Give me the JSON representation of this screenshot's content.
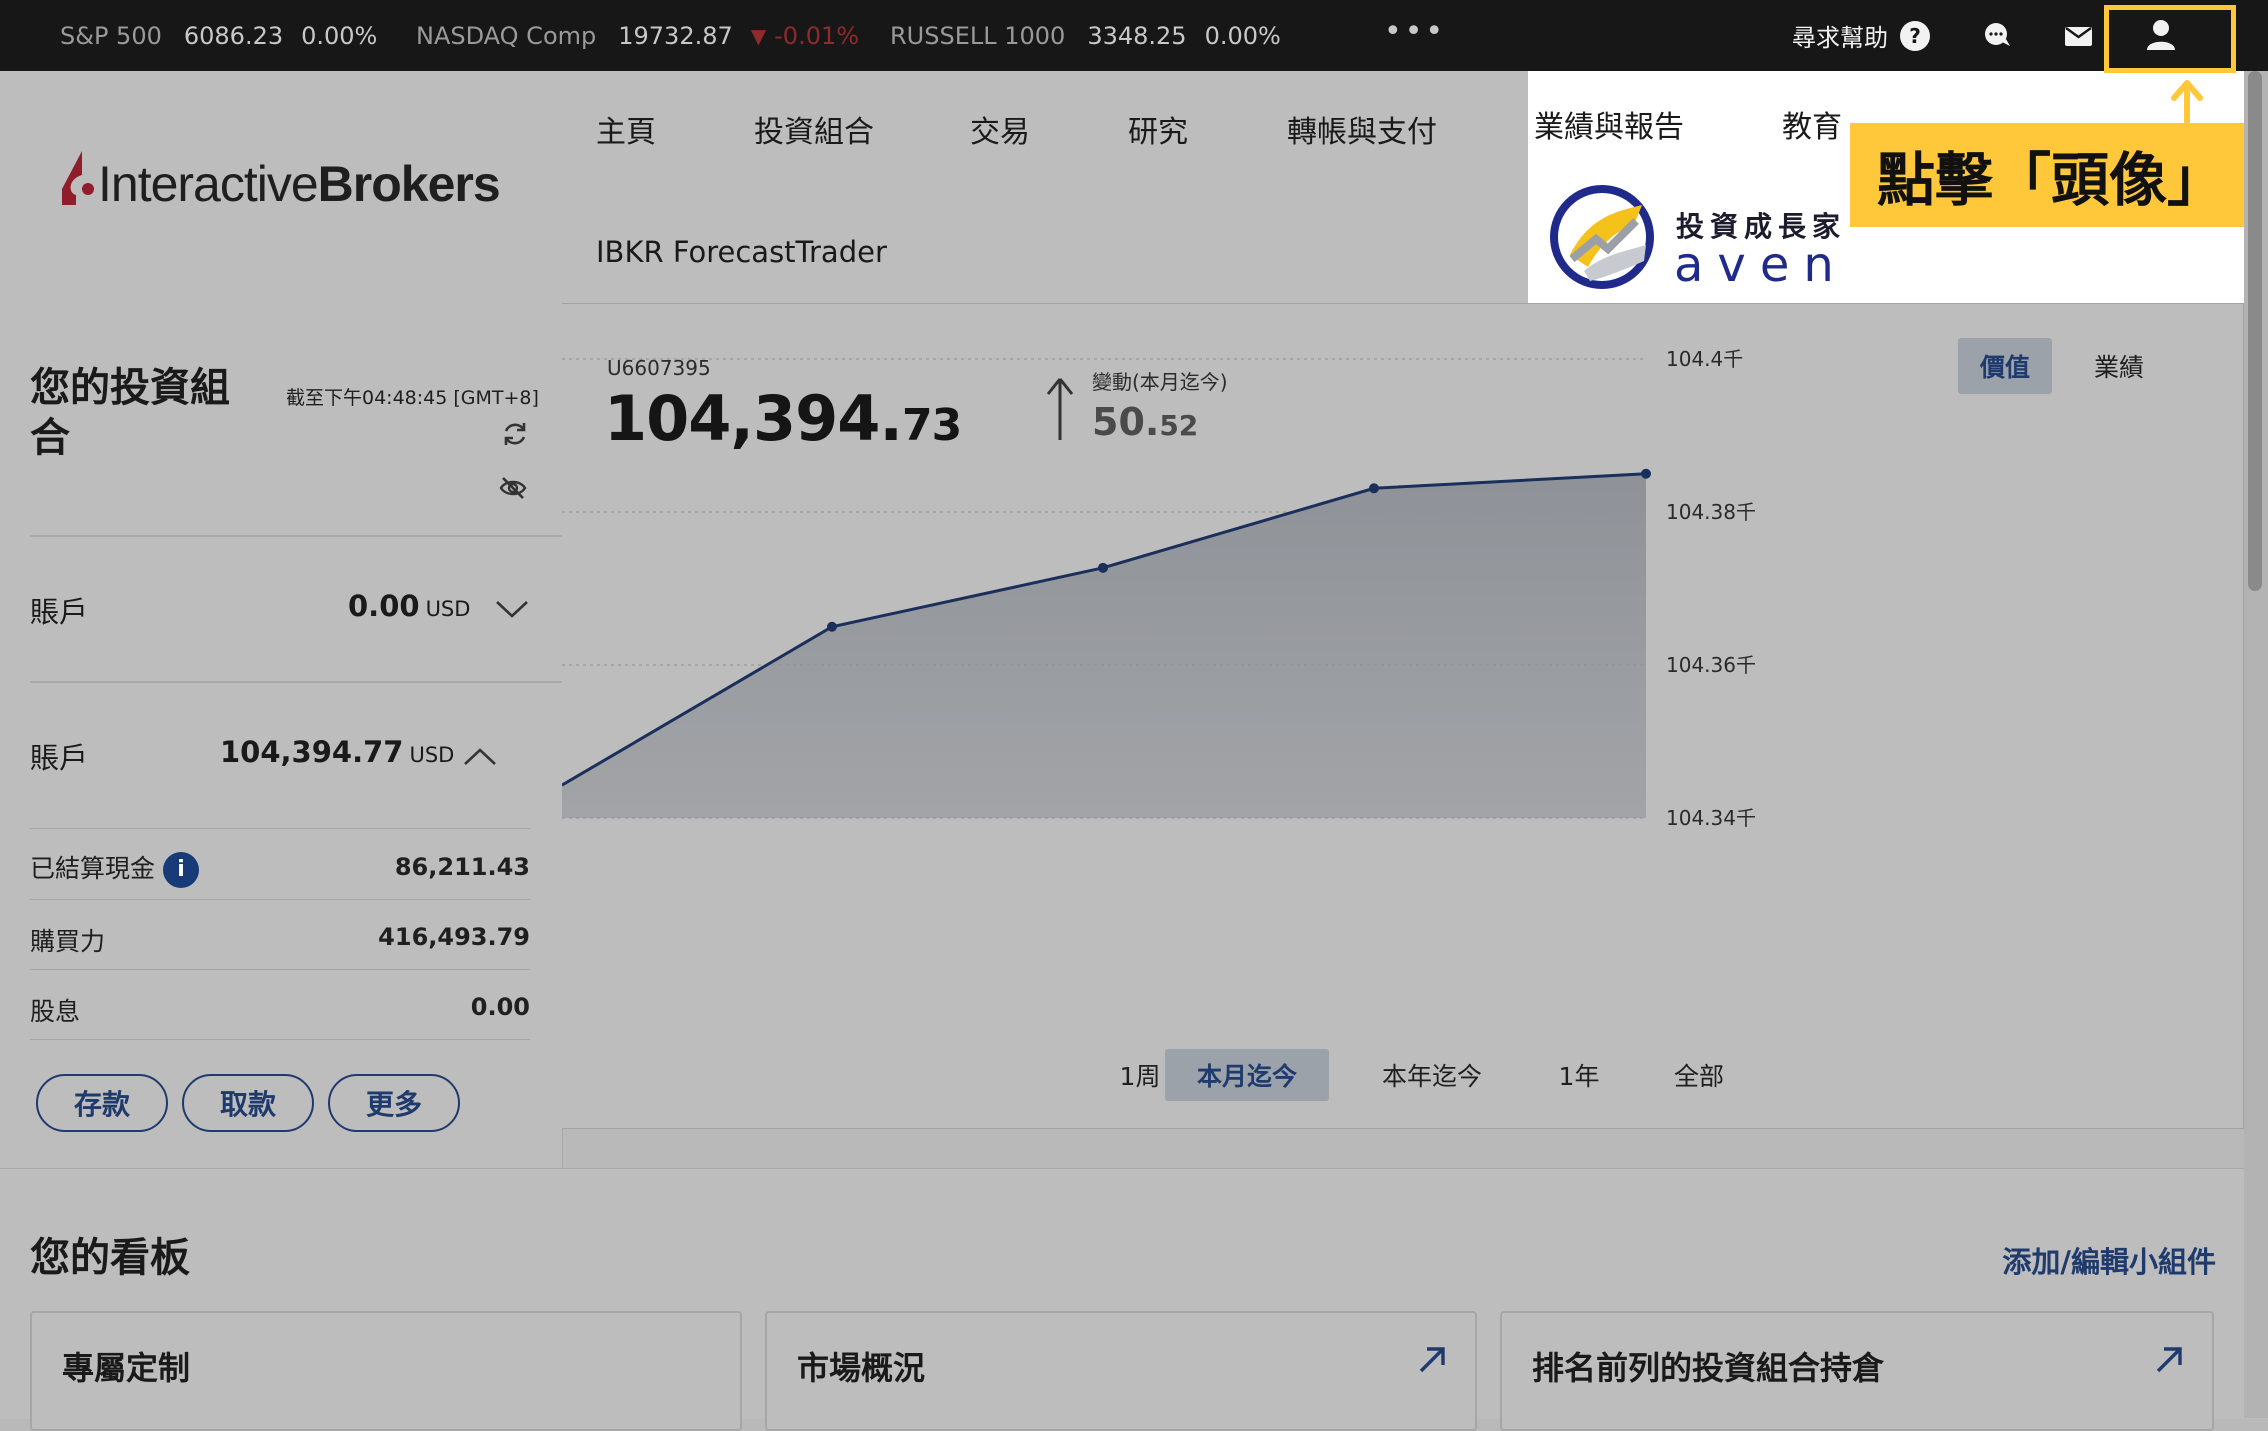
{
  "ticker": {
    "items": [
      {
        "name": "S&P 500",
        "value": "6086.23",
        "change": "0.00%"
      },
      {
        "name": "NASDAQ Comp",
        "value": "19732.87",
        "change": "-0.01%"
      },
      {
        "name": "RUSSELL 1000",
        "value": "3348.25",
        "change": "0.00%"
      }
    ],
    "more": "•••",
    "help_label": "尋求幫助",
    "help_glyph": "?"
  },
  "brand": {
    "left": "Interactive",
    "right": "Brokers"
  },
  "nav": {
    "items": [
      "主頁",
      "投資組合",
      "交易",
      "研究",
      "轉帳與支付",
      "業績與報告",
      "教育"
    ],
    "row2": "IBKR ForecastTrader"
  },
  "overlay": {
    "callout": "點擊「頭像」",
    "brand_cn": "投資成長家",
    "brand_en": "aven"
  },
  "portfolio": {
    "title": "您的投資組合",
    "timestamp": "截至下午04:48:45 [GMT+8]",
    "account1": {
      "label": "賬戶",
      "value": "0.00",
      "currency": "USD"
    },
    "account2": {
      "label": "賬戶",
      "value": "104,394.77",
      "currency": "USD"
    },
    "rows": [
      {
        "label": "已結算現金",
        "value": "86,211.43"
      },
      {
        "label": "購買力",
        "value": "416,493.79"
      },
      {
        "label": "股息",
        "value": "0.00"
      }
    ],
    "buttons": [
      "存款",
      "取款",
      "更多"
    ]
  },
  "summary": {
    "account_id": "U6607395",
    "value_main": "104,394.",
    "value_cents": "73",
    "change_label": "變動(本月迄今)",
    "change_main": "50.",
    "change_cents": "52",
    "toggle": [
      "價值",
      "業績"
    ],
    "ranges": [
      "1周",
      "本月迄今",
      "本年迄今",
      "1年",
      "全部"
    ],
    "active_range": "本月迄今"
  },
  "chart_data": {
    "type": "area",
    "x": [
      0,
      1,
      2,
      3,
      4
    ],
    "values": [
      104.3443,
      104.365,
      104.3727,
      104.3831,
      104.385
    ],
    "ylim": [
      104.34,
      104.4
    ],
    "y_ticks": [
      "104.4千",
      "104.38千",
      "104.36千",
      "104.34千"
    ],
    "y_tick_values": [
      104.4,
      104.38,
      104.36,
      104.34
    ],
    "grid": true,
    "line_color": "#1b2f5c",
    "fill_color": "#8c9096"
  },
  "board": {
    "title": "您的看板",
    "edit_link": "添加/編輯小組件",
    "cards": [
      "專屬定制",
      "市場概況",
      "排名前列的投資組合持倉"
    ]
  },
  "colors": {
    "accent": "#1f3a6c",
    "highlight": "#ffc83a",
    "negative": "#8f2b2b"
  }
}
